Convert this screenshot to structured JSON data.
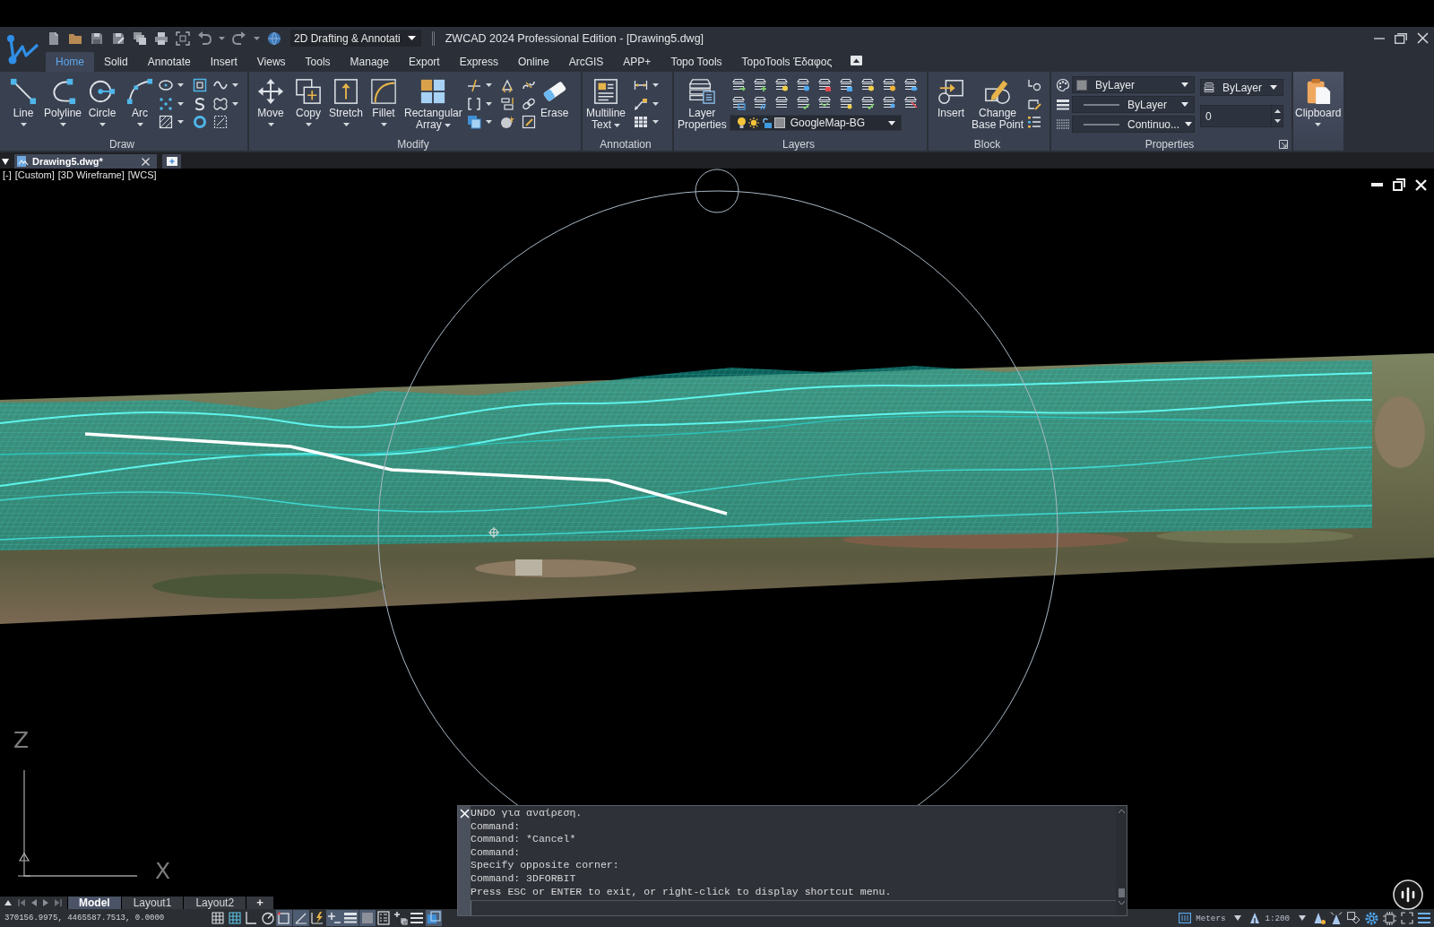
{
  "title_bar": {
    "workspace": "2D Drafting & Annotati",
    "title": "ZWCAD 2024 Professional Edition - [Drawing5.dwg]"
  },
  "tabs": [
    {
      "label": "Home",
      "selected": true
    },
    {
      "label": "Solid",
      "selected": false
    },
    {
      "label": "Annotate",
      "selected": false
    },
    {
      "label": "Insert",
      "selected": false
    },
    {
      "label": "Views",
      "selected": false
    },
    {
      "label": "Tools",
      "selected": false
    },
    {
      "label": "Manage",
      "selected": false
    },
    {
      "label": "Export",
      "selected": false
    },
    {
      "label": "Express",
      "selected": false
    },
    {
      "label": "Online",
      "selected": false
    },
    {
      "label": "ArcGIS",
      "selected": false
    },
    {
      "label": "APP+",
      "selected": false
    },
    {
      "label": "Topo Tools",
      "selected": false
    },
    {
      "label": "TopoTools Έδαφος",
      "selected": false
    }
  ],
  "ribbon": {
    "draw": {
      "title": "Draw",
      "buttons": [
        {
          "kind": "line",
          "label": "Line",
          "dropdown": true
        },
        {
          "kind": "polyline",
          "label": "Polyline",
          "dropdown": true
        },
        {
          "kind": "circle",
          "label": "Circle",
          "dropdown": true
        },
        {
          "kind": "arc",
          "label": "Arc",
          "dropdown": true
        }
      ]
    },
    "modify": {
      "title": "Modify",
      "buttons": [
        {
          "kind": "move",
          "label": "Move",
          "dropdown": true
        },
        {
          "kind": "copy",
          "label": "Copy",
          "dropdown": true
        },
        {
          "kind": "stretch",
          "label": "Stretch",
          "dropdown": true
        },
        {
          "kind": "fillet",
          "label": "Fillet",
          "dropdown": true
        },
        {
          "kind": "array",
          "label": "Rectangular\nArray",
          "dropdown": true
        }
      ],
      "trailing_buttons": [
        {
          "kind": "erase",
          "label": "Erase",
          "dropdown": false
        }
      ]
    },
    "annotation": {
      "title": "Annotation",
      "buttons": [
        {
          "kind": "mtext",
          "label": "Multiline\nText",
          "dropdown": true
        }
      ]
    },
    "layers": {
      "title": "Layers",
      "buttons": [
        {
          "kind": "layers",
          "label": "Layer\nProperties",
          "dropdown": false
        }
      ],
      "current_layer": "GoogleMap-BG"
    },
    "block": {
      "title": "Block",
      "buttons": [
        {
          "kind": "insert",
          "label": "Insert",
          "dropdown": false
        },
        {
          "kind": "basepoint",
          "label": "Change\nBase Point",
          "dropdown": false
        }
      ]
    },
    "properties": {
      "title": "Properties",
      "color_select": "ByLayer",
      "lineweight_select": "ByLayer",
      "linetype_select": "Continuo...",
      "dropdown_4": "ByLayer",
      "number_field": "0"
    },
    "clipboard": {
      "kind": "clipboard",
      "label": "Clipboard",
      "dropdown": true
    }
  },
  "document_tabs": [
    {
      "label": "Drawing5.dwg*",
      "selected": true
    }
  ],
  "viewport": {
    "controls": [
      "[-]",
      "[Custom]",
      "[3D Wireframe]",
      "[WCS]"
    ],
    "axis_z": "Z",
    "axis_x": "X"
  },
  "command_window": {
    "history": [
      "UNDO για αναίρεση.",
      "Command:",
      "Command: *Cancel*",
      "Command:",
      "Specify opposite corner:",
      "Command: 3DFORBIT",
      "Press ESC or ENTER to exit, or right-click to display shortcut menu."
    ]
  },
  "layout_tabs": [
    {
      "label": "Model",
      "selected": true
    },
    {
      "label": "Layout1",
      "selected": false
    },
    {
      "label": "Layout2",
      "selected": false
    }
  ],
  "add_layout": "+",
  "status_bar": {
    "coordinates": "370156.9975, 4465587.7513, 0.0000",
    "toggles": [
      {
        "kind": "grid",
        "on": false
      },
      {
        "kind": "snap",
        "on": false
      },
      {
        "kind": "ortho",
        "on": false
      },
      {
        "kind": "polar",
        "on": false
      },
      {
        "kind": "osnap",
        "on": true
      },
      {
        "kind": "otrack",
        "on": true
      },
      {
        "kind": "ducs",
        "on": false
      },
      {
        "kind": "dyn",
        "on": true
      },
      {
        "kind": "lweight",
        "on": true
      },
      {
        "kind": "transparency",
        "on": true
      },
      {
        "kind": "qp",
        "on": false
      },
      {
        "kind": "selcycle",
        "on": false
      },
      {
        "kind": "menu",
        "on": false
      },
      {
        "kind": "isolate",
        "on": true
      }
    ],
    "units": "Meters",
    "annotation_scale": "1:200"
  }
}
